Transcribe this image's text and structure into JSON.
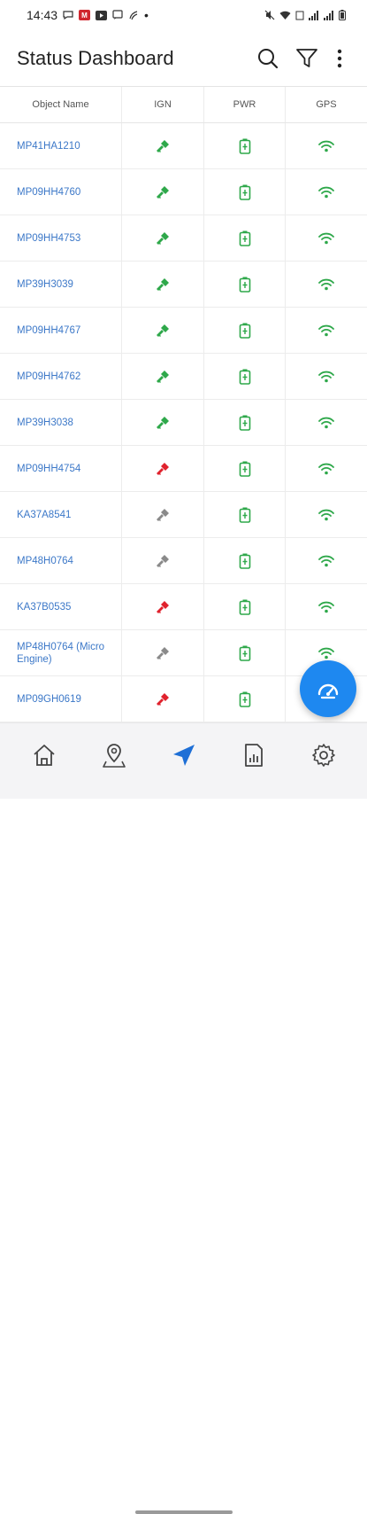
{
  "status_bar": {
    "time": "14:43",
    "left_icons": [
      "chat-icon",
      "mail-badge-icon",
      "youtube-icon",
      "sms-icon",
      "wifi-call-icon",
      "dot-icon"
    ],
    "right_icons": [
      "mute-icon",
      "wifi-icon",
      "volte-icon",
      "signal-icon",
      "signal-icon-2",
      "battery-icon"
    ]
  },
  "header": {
    "title": "Status Dashboard",
    "actions": [
      "search-icon",
      "filter-icon",
      "more-vert-icon"
    ]
  },
  "table": {
    "columns": [
      "Object Name",
      "IGN",
      "PWR",
      "GPS"
    ],
    "rows": [
      {
        "name": "MP41HA1210",
        "ign": "green",
        "pwr": "green",
        "gps": "green"
      },
      {
        "name": "MP09HH4760",
        "ign": "green",
        "pwr": "green",
        "gps": "green"
      },
      {
        "name": "MP09HH4753",
        "ign": "green",
        "pwr": "green",
        "gps": "green"
      },
      {
        "name": "MP39H3039",
        "ign": "green",
        "pwr": "green",
        "gps": "green"
      },
      {
        "name": "MP09HH4767",
        "ign": "green",
        "pwr": "green",
        "gps": "green"
      },
      {
        "name": "MP09HH4762",
        "ign": "green",
        "pwr": "green",
        "gps": "green"
      },
      {
        "name": "MP39H3038",
        "ign": "green",
        "pwr": "green",
        "gps": "green"
      },
      {
        "name": "MP09HH4754",
        "ign": "red",
        "pwr": "green",
        "gps": "green"
      },
      {
        "name": "KA37A8541",
        "ign": "grey",
        "pwr": "green",
        "gps": "green"
      },
      {
        "name": "MP48H0764",
        "ign": "grey",
        "pwr": "green",
        "gps": "green"
      },
      {
        "name": "KA37B0535",
        "ign": "red",
        "pwr": "green",
        "gps": "green"
      },
      {
        "name": "MP48H0764 (Micro Engine)",
        "ign": "grey",
        "pwr": "green",
        "gps": "green"
      },
      {
        "name": "MP09GH0619",
        "ign": "red",
        "pwr": "green",
        "gps": "green"
      }
    ]
  },
  "colors": {
    "green": "#2ea84a",
    "red": "#e0222d",
    "grey": "#8a8a8a",
    "link": "#3c78c8",
    "accent": "#1e88f0",
    "nav_active": "#1e6fd6"
  },
  "fab": {
    "icon": "speedometer-icon"
  },
  "bottom_nav": {
    "items": [
      {
        "icon": "home-icon",
        "active": false
      },
      {
        "icon": "map-pin-icon",
        "active": false
      },
      {
        "icon": "navigation-arrow-icon",
        "active": true
      },
      {
        "icon": "report-icon",
        "active": false
      },
      {
        "icon": "settings-icon",
        "active": false
      }
    ]
  }
}
